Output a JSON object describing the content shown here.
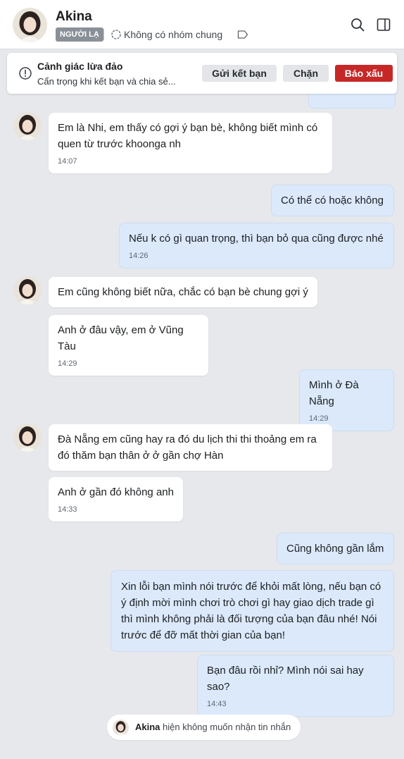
{
  "header": {
    "name": "Akina",
    "badge": "NGƯỜI LẠ",
    "group_text": "Không có nhóm chung",
    "icons": [
      "refresh-circle-icon",
      "tag-icon",
      "search-icon",
      "layout-panel-icon"
    ]
  },
  "warning": {
    "title": "Cảnh giác lừa đảo",
    "description": "Cẩn trọng khi kết bạn và chia sẻ...",
    "buttons": {
      "add_friend": "Gửi kết bạn",
      "block": "Chặn",
      "report": "Báo xấu"
    }
  },
  "messages": [
    {
      "dir": "in",
      "text": "Em là Nhi, em thấy có gợi ý bạn bè, không biết mình có quen từ trước khoonga nh",
      "time": "14:07"
    },
    {
      "dir": "out",
      "text": "Có thể có hoặc không",
      "time": ""
    },
    {
      "dir": "out",
      "text": "Nếu k có gì quan trọng, thì bạn bỏ qua cũng được nhé",
      "time": "14:26"
    },
    {
      "dir": "in",
      "text": "Em cũng không biết nữa, chắc có bạn bè chung gợi ý",
      "time": ""
    },
    {
      "dir": "in",
      "text": "Anh ở đâu vậy, em ở Vũng Tàu",
      "time": "14:29"
    },
    {
      "dir": "out",
      "text": "Mình ở Đà Nẵng",
      "time": "14:29"
    },
    {
      "dir": "in",
      "text": "Đà Nẵng em cũng hay ra đó du lịch thi thi thoảng em ra đó thăm  bạn thân ở ở gần chợ Hàn",
      "time": ""
    },
    {
      "dir": "in",
      "text": "Anh ở gần đó không anh",
      "time": "14:33"
    },
    {
      "dir": "out",
      "text": "Cũng không gần lắm",
      "time": ""
    },
    {
      "dir": "out",
      "text": "Xin lỗi bạn mình nói trước để khỏi mất lòng, nếu bạn có ý định mời mình chơi trò chơi gì hay giao dịch trade gì thì mình không phải là đối tượng của bạn đâu nhé! Nói trước để đỡ mất thời gian của bạn!",
      "time": ""
    },
    {
      "dir": "out",
      "text": "Bạn đâu rồi nhỉ? Mình nói sai hay sao?",
      "time": "14:43"
    }
  ],
  "status": {
    "name": "Akina",
    "text": "hiện không muốn nhận tin nhắn"
  },
  "colors": {
    "background": "#e6e8ec",
    "outgoing_bubble": "#dbe9fb",
    "incoming_bubble": "#ffffff",
    "report_button": "#c62828"
  }
}
